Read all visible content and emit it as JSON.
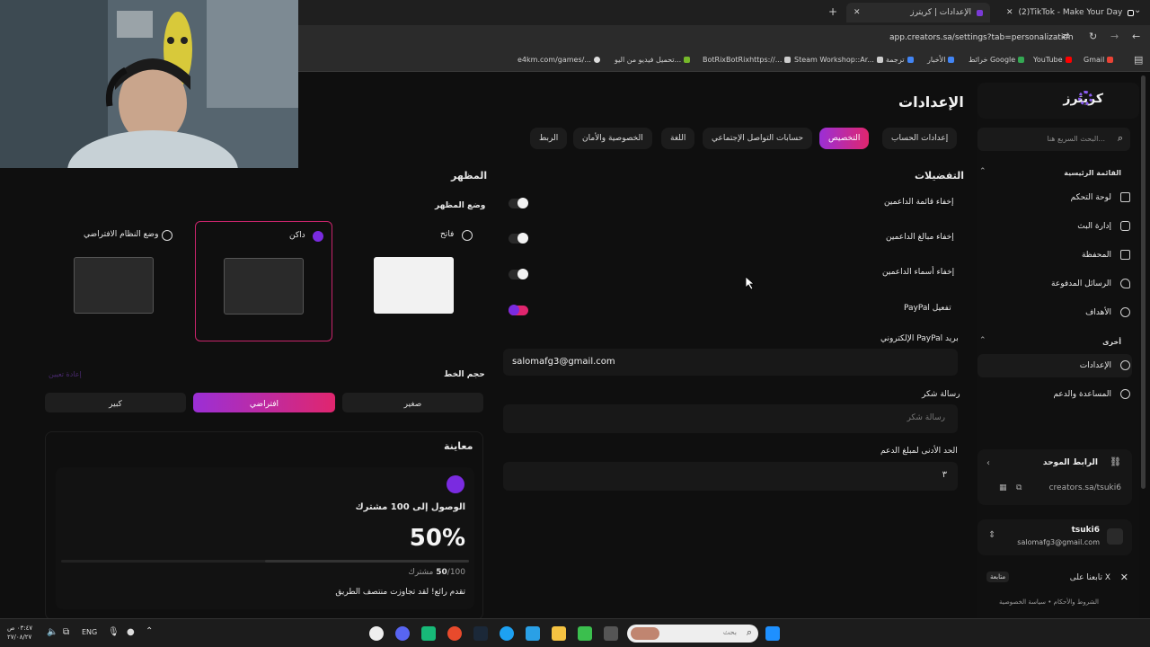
{
  "browser": {
    "tabs": [
      {
        "label": "(2)TikTok - Make Your Day",
        "active": false
      },
      {
        "label": "الإعدادات | كريترز",
        "active": true
      }
    ],
    "new_tab_symbol": "+",
    "url": "app.creators.sa/settings?tab=personalization",
    "bookmarks": [
      {
        "label": "Gmail",
        "color": "#ea4335"
      },
      {
        "label": "YouTube",
        "color": "#ff0000"
      },
      {
        "label": "خرائط Google",
        "color": "#34a853"
      },
      {
        "label": "الأخبار",
        "color": "#4285f4"
      },
      {
        "label": "ترجمة",
        "color": "#4285f4"
      },
      {
        "label": "Steam Workshop::Ar...",
        "color": "#cccccc"
      },
      {
        "label": "BotRixBotRixhttps://...",
        "color": "#cccccc"
      },
      {
        "label": "تحميل فيديو من اليو...",
        "color": "#76b82a"
      },
      {
        "label": "e4km.com/games/...",
        "color": "#dddddd"
      }
    ]
  },
  "sidebar": {
    "logo": "كريترز",
    "search_placeholder": "البحث السريع هنا...",
    "main_section": "القائمة الرئيسية",
    "main_items": [
      {
        "label": "لوحة التحكم",
        "icon": "grid-icon"
      },
      {
        "label": "إدارة البث",
        "icon": "video-icon"
      },
      {
        "label": "المحفظة",
        "icon": "wallet-icon"
      },
      {
        "label": "الرسائل المدفوعة",
        "icon": "message-icon"
      },
      {
        "label": "الأهداف",
        "icon": "target-icon"
      }
    ],
    "other_section": "أخرى",
    "other_items": [
      {
        "label": "الإعدادات",
        "icon": "gear-icon"
      },
      {
        "label": "المساعدة والدعم",
        "icon": "info-icon"
      }
    ],
    "unified_link_title": "الرابط الموحد",
    "unified_link_url": "creators.sa/tsuki6",
    "user_name": "tsuki6",
    "user_email": "salomafg3@gmail.com",
    "follow_text": "تابعنا على X",
    "follow_badge": "متابعة",
    "footer_terms": "الشروط والأحكام",
    "footer_separator": "•",
    "footer_privacy": "سياسة الخصوصية"
  },
  "header": {
    "title": "الإعدادات",
    "tabs": [
      "إعدادات الحساب",
      "التخصيص",
      "حسابات التواصل الإجتماعي",
      "اللغة",
      "الخصوصية والأمان",
      "الربط"
    ],
    "active_tab": "التخصيص"
  },
  "preferences": {
    "title": "التفضيلات",
    "hide_supporters_list": "إخفاء قائمة الداعمين",
    "hide_support_amounts": "إخفاء مبالغ الداعمين",
    "hide_supporter_names": "إخفاء أسماء الداعمين",
    "enable_paypal": "تفعيل PayPal",
    "paypal_email_label": "بريد PayPal الإلكتروني",
    "paypal_email_value": "salomafg3@gmail.com",
    "thanks_label": "رسالة شكر",
    "thanks_placeholder": "رسالة شكر",
    "min_amount_label": "الحد الأدنى لمبلغ الدعم",
    "min_amount_value": "٣"
  },
  "appearance": {
    "title": "المظهر",
    "mode_label": "وضع المظهر",
    "light_label": "فاتح",
    "dark_label": "داكن",
    "system_label": "وضع النظام الافتراضي",
    "selected_mode": "داكن",
    "font_size_label": "حجم الخط",
    "small": "صغير",
    "default": "افتراضي",
    "large": "كبير",
    "faded_hint": "إعادة تعيين"
  },
  "preview": {
    "title": "معاينة",
    "goal_title": "الوصول إلى 100 مشترك",
    "percent": "50%",
    "progress_fraction": 0.5,
    "count_current": "50",
    "count_sep": "/100",
    "count_unit": "مشترك",
    "message": "تقدم رائع! لقد تجاوزت منتصف الطريق"
  },
  "taskbar": {
    "time": "٠٣:٤٧ ص",
    "date": "٢٧/٠٨/٢٧",
    "lang": "ENG",
    "search_placeholder": "بحث"
  },
  "colors": {
    "accent_purple": "#9b2fd6",
    "accent_pink": "#e0266e",
    "background": "#0f0f0f"
  }
}
